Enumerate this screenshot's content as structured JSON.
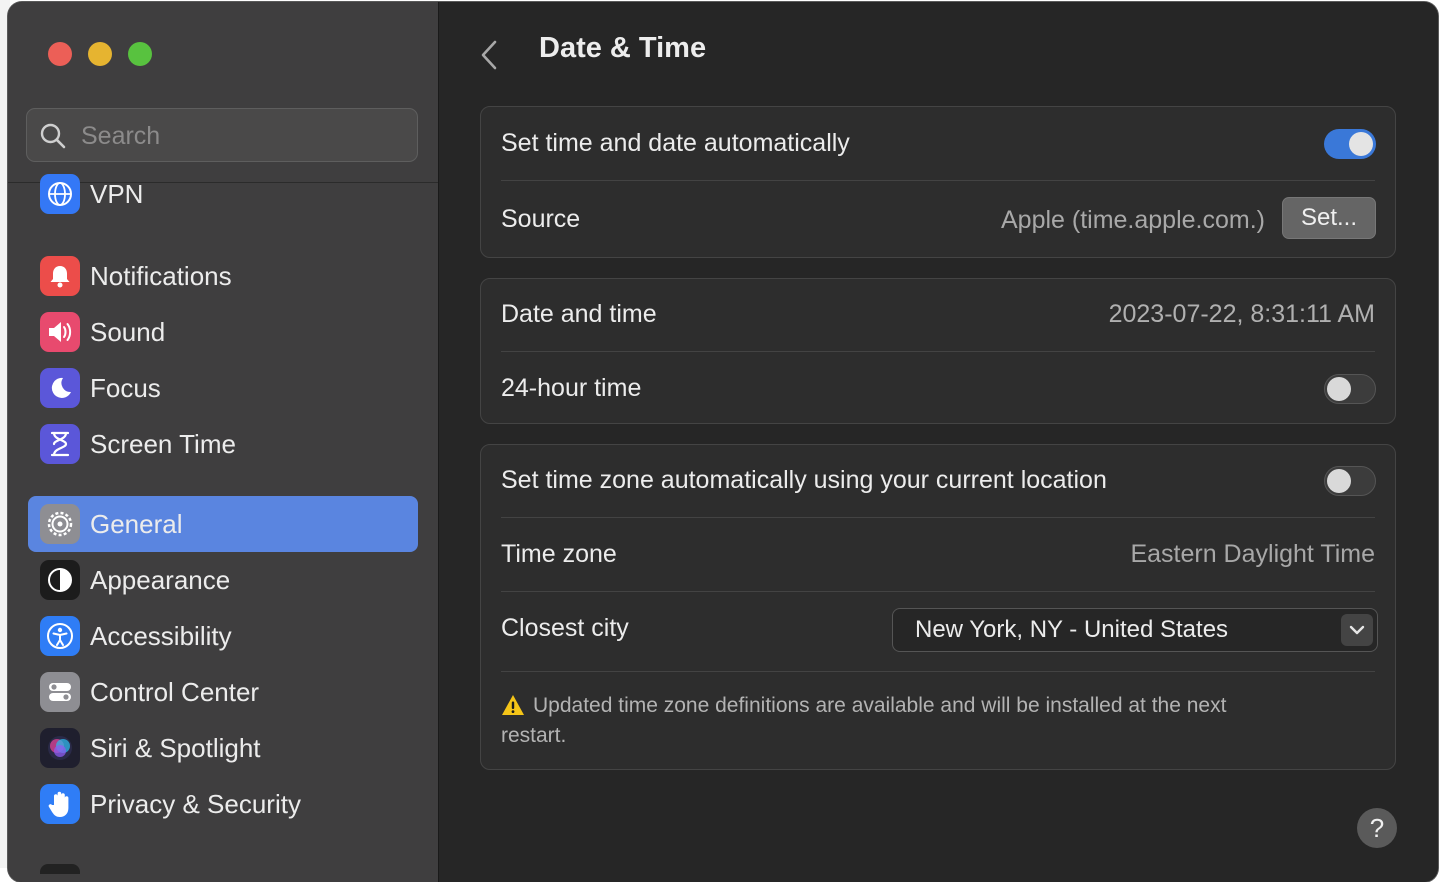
{
  "window": {
    "title": "Date & Time"
  },
  "search": {
    "placeholder": "Search"
  },
  "sidebar": {
    "items": [
      {
        "label": "VPN",
        "icon": "globe-icon",
        "color": "#3478f6"
      },
      {
        "label": "Notifications",
        "icon": "bell-icon",
        "color": "#ec4d4a"
      },
      {
        "label": "Sound",
        "icon": "speaker-icon",
        "color": "#e84a6e"
      },
      {
        "label": "Focus",
        "icon": "moon-icon",
        "color": "#5b57d9"
      },
      {
        "label": "Screen Time",
        "icon": "hourglass-icon",
        "color": "#5b57d9"
      },
      {
        "label": "General",
        "icon": "gear-icon",
        "color": "#8e8e93",
        "selected": true
      },
      {
        "label": "Appearance",
        "icon": "appearance-icon",
        "color": "#1c1c1c"
      },
      {
        "label": "Accessibility",
        "icon": "accessibility-icon",
        "color": "#2f7df6"
      },
      {
        "label": "Control Center",
        "icon": "control-center-icon",
        "color": "#8e8e93"
      },
      {
        "label": "Siri & Spotlight",
        "icon": "siri-icon",
        "color": "#1f1f2e"
      },
      {
        "label": "Privacy & Security",
        "icon": "hand-icon",
        "color": "#2f7df6"
      }
    ]
  },
  "main": {
    "title": "Date & Time",
    "auto_time": {
      "label": "Set time and date automatically",
      "enabled": true
    },
    "source": {
      "label": "Source",
      "value": "Apple (time.apple.com.)",
      "button": "Set..."
    },
    "date_time": {
      "label": "Date and time",
      "value": "2023-07-22, 8:31:11 AM"
    },
    "hour24": {
      "label": "24-hour time",
      "enabled": false
    },
    "auto_zone": {
      "label": "Set time zone automatically using your current location",
      "enabled": false
    },
    "time_zone": {
      "label": "Time zone",
      "value": "Eastern Daylight Time"
    },
    "closest_city": {
      "label": "Closest city",
      "value": "New York, NY - United States"
    },
    "notice": "Updated time zone definitions are available and will be installed at the next restart.",
    "help": "?"
  },
  "colors": {
    "accent": "#3a78d8",
    "selected": "#5a85e0",
    "warning": "#f5c518"
  }
}
